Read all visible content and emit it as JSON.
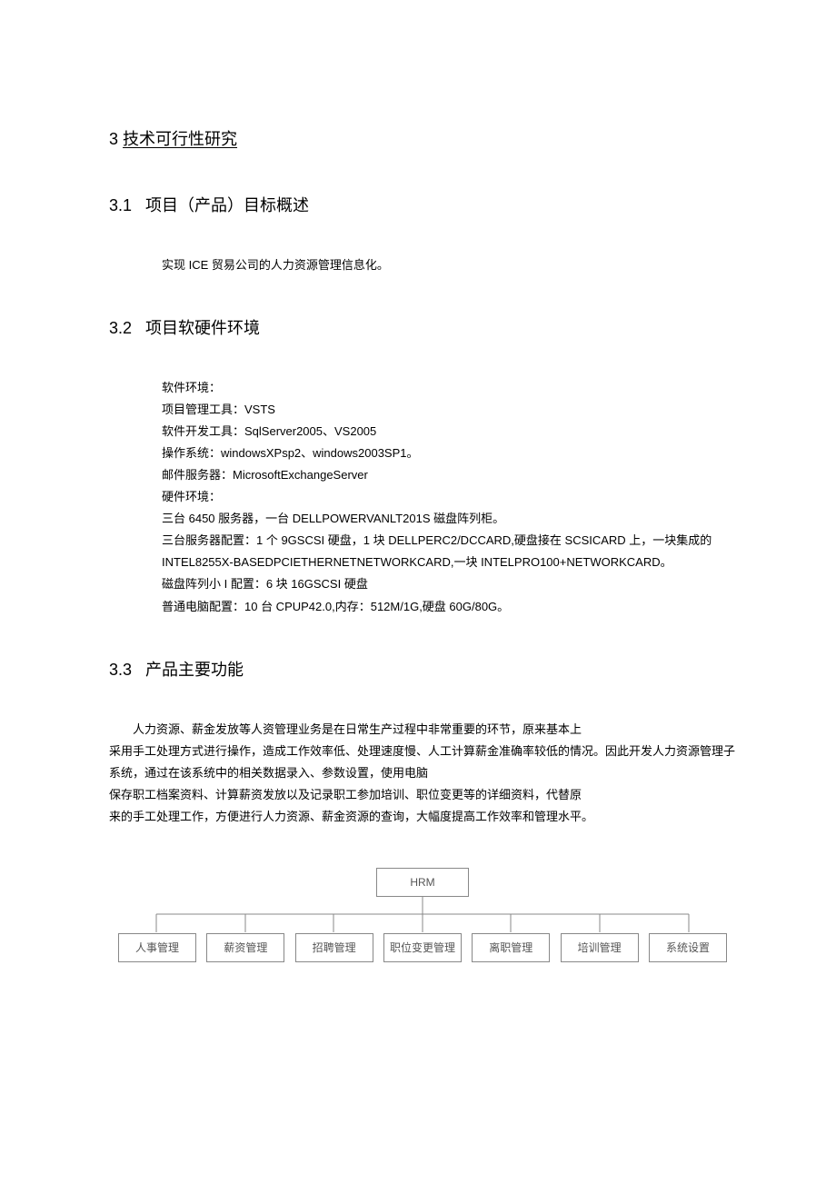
{
  "doc": {
    "h1_num": "3",
    "h1_title": "技术可行性研究",
    "section31": {
      "num": "3.1",
      "title": "项目（产品）目标概述",
      "p": "实现 ICE 贸易公司的人力资源管理信息化。"
    },
    "section32": {
      "num": "3.2",
      "title": "项目软硬件环境",
      "lines": [
        "软件环境：",
        "项目管理工具：VSTS",
        "软件开发工具：SqlServer2005、VS2005",
        "操作系统：windowsXPsp2、windows2003SP1。",
        "邮件服务器：MicrosoftExchangeServer",
        "硬件环境：",
        "三台 6450 服务器，一台 DELLPOWERVANLT201S 磁盘阵列柜。",
        "三台服务器配置：1 个 9GSCSI 硬盘，1 块 DELLPERC2/DCCARD,硬盘接在 SCSICARD 上，一块集成的 INTEL8255X-BASEDPCIETHERNETNETWORKCARD,一块 INTELPRO100+NETWORKCARD。",
        "磁盘阵列小 I 配置：6 块 16GSCSI 硬盘",
        "普通电脑配置：10 台 CPUP42.0,内存：512M/1G,硬盘 60G/80G。"
      ]
    },
    "section33": {
      "num": "3.3",
      "title": "产品主要功能",
      "lines": [
        "人力资源、薪金发放等人资管理业务是在日常生产过程中非常重要的环节，原来基本上",
        "采用手工处理方式进行操作，造成工作效率低、处理速度慢、人工计算薪金准确率较低的情况。因此开发人力资源管理子系统，通过在该系统中的相关数据录入、参数设置，使用电脑",
        "保存职工档案资料、计算薪资发放以及记录职工参加培训、职位变更等的详细资料，代替原",
        "来的手工处理工作，方便进行人力资源、薪金资源的查询，大幅度提高工作效率和管理水平。"
      ]
    }
  },
  "chart_data": {
    "type": "diagram",
    "root": "HRM",
    "children": [
      "人事管理",
      "薪资管理",
      "招聘管理",
      "职位变更管理",
      "离职管理",
      "培训管理",
      "系统设置"
    ]
  }
}
